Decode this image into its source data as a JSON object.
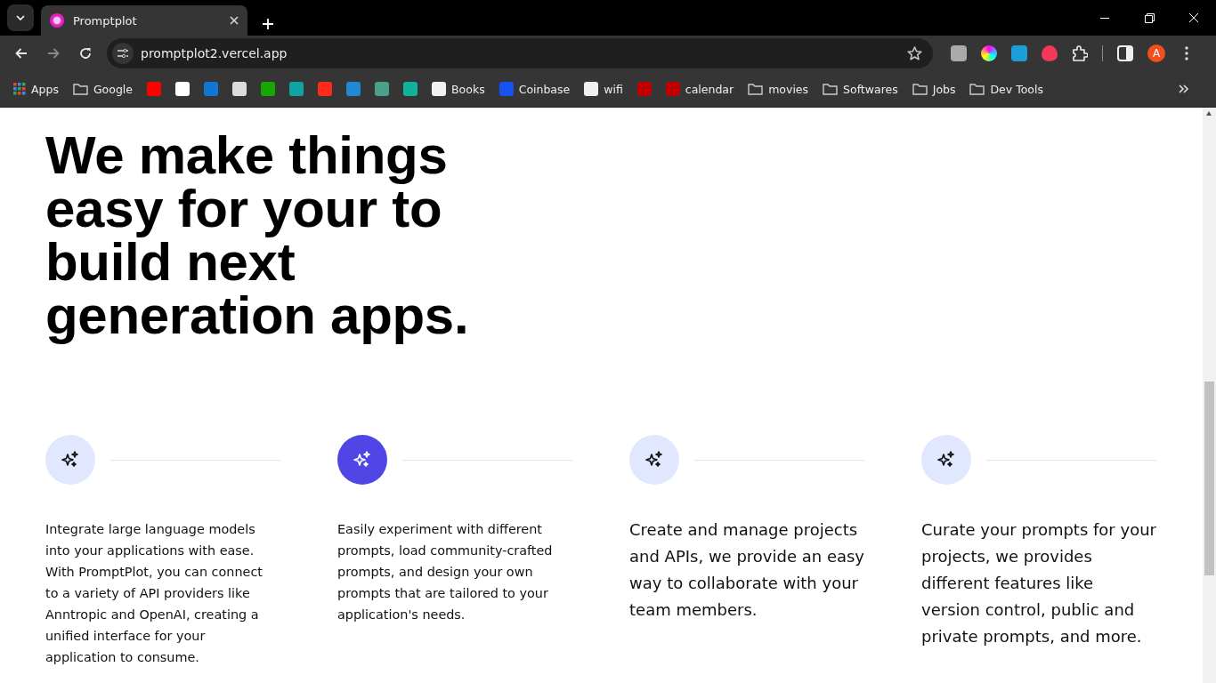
{
  "browser": {
    "tab": {
      "title": "Promptplot",
      "selected": true
    },
    "url": "promptplot2.vercel.app",
    "profile_initial": "A",
    "bookmarks": [
      {
        "kind": "apps",
        "label": "Apps"
      },
      {
        "kind": "folder",
        "label": "Google"
      },
      {
        "kind": "site",
        "color": "#ff0000"
      },
      {
        "kind": "site",
        "color": "#ffffff"
      },
      {
        "kind": "site",
        "color": "#0f78d4"
      },
      {
        "kind": "site",
        "color": "#dddddd"
      },
      {
        "kind": "site",
        "color": "#14a800"
      },
      {
        "kind": "site",
        "color": "#0fa3a3"
      },
      {
        "kind": "site",
        "color": "#ff2a1a"
      },
      {
        "kind": "site",
        "color": "#1f8ad2"
      },
      {
        "kind": "site",
        "color": "#4aa08a"
      },
      {
        "kind": "site",
        "color": "#10b39a"
      },
      {
        "kind": "site",
        "label": "Books",
        "color": "#f2f2f2"
      },
      {
        "kind": "site",
        "label": "Coinbase",
        "color": "#1652f0"
      },
      {
        "kind": "site",
        "label": "wifi",
        "color": "#f0f0f0"
      },
      {
        "kind": "site",
        "color": "#c00000"
      },
      {
        "kind": "site",
        "label": "calendar",
        "color": "#c00000"
      },
      {
        "kind": "folder",
        "label": "movies"
      },
      {
        "kind": "folder",
        "label": "Softwares"
      },
      {
        "kind": "folder",
        "label": "Jobs"
      },
      {
        "kind": "folder",
        "label": "Dev Tools"
      }
    ]
  },
  "hero": {
    "heading": "We make things easy for your to build next generation apps."
  },
  "features": [
    {
      "selected": false,
      "kind": "small",
      "text": "Integrate large language models into your applications with ease. With PromptPlot, you can connect to a variety of API providers like Anntropic and OpenAI, creating a unified interface for your application to consume."
    },
    {
      "selected": true,
      "kind": "small",
      "text": "Easily experiment with different prompts, load community-crafted prompts, and design your own prompts that are tailored to your application's needs."
    },
    {
      "selected": false,
      "kind": "large",
      "text": "Create and manage projects and APIs, we provide an easy way to collaborate with your team members."
    },
    {
      "selected": false,
      "kind": "large",
      "text": "Curate your prompts for your projects, we provides different features like version control, public and private prompts, and more."
    }
  ]
}
